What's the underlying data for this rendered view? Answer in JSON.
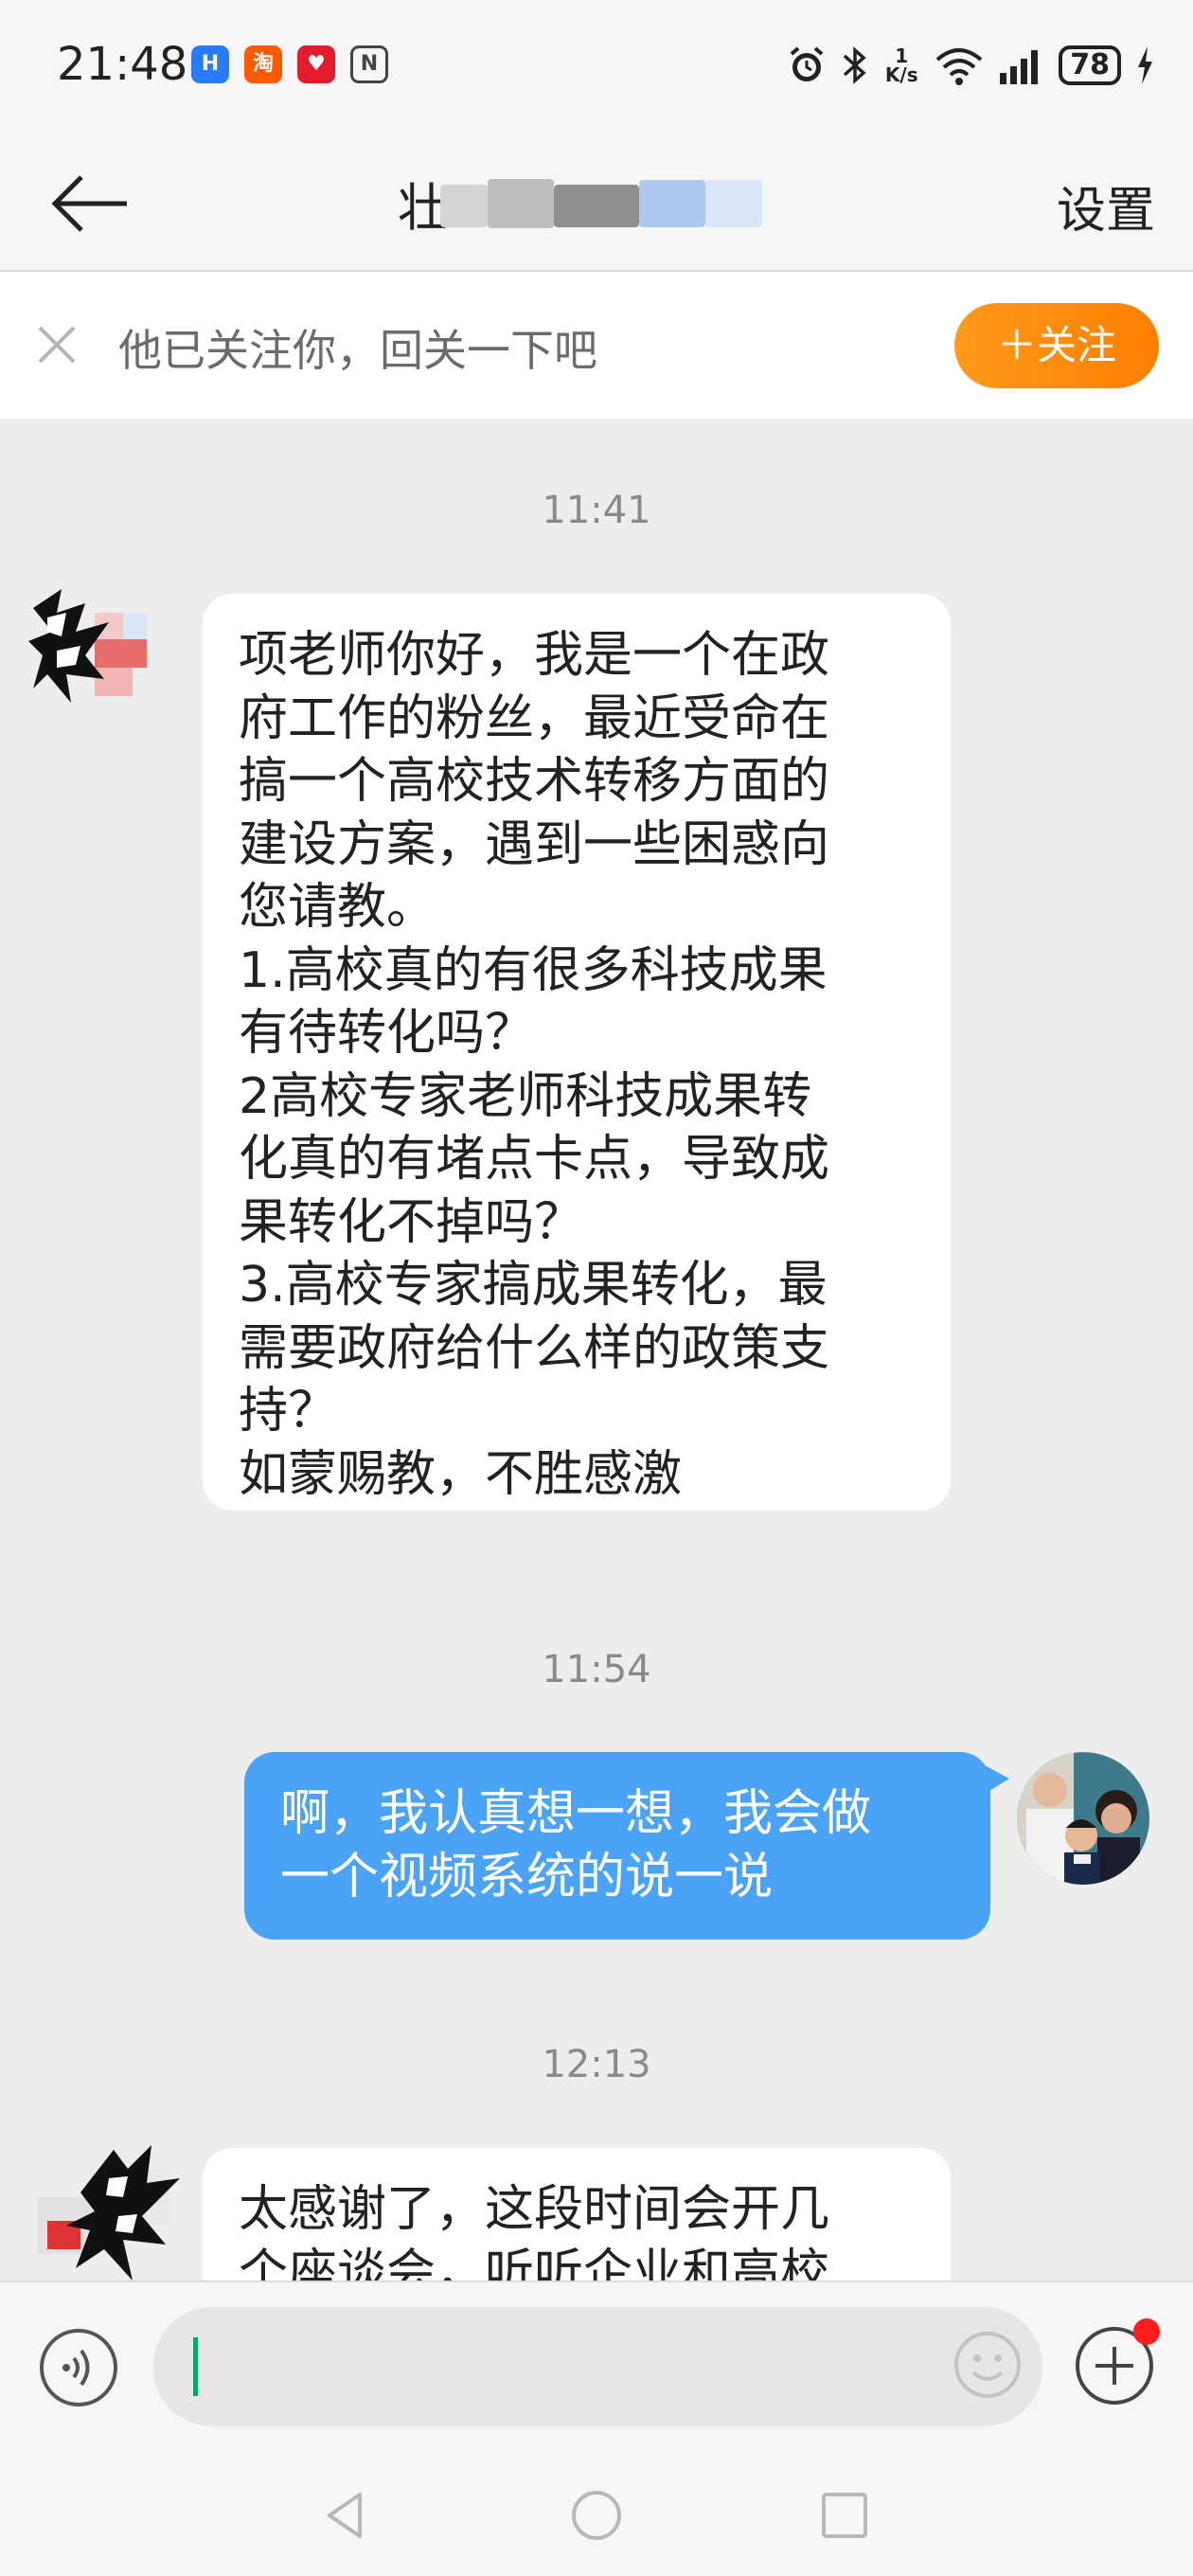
{
  "status_bar": {
    "time": "21:48",
    "apps": [
      {
        "icon": "app-blue-icon",
        "label": "H",
        "color": "#2a7cf6"
      },
      {
        "icon": "taobao-icon",
        "label": "淘",
        "color": "#ff5a00"
      },
      {
        "icon": "app-red-icon",
        "label": "♥",
        "color": "#e21b2d"
      },
      {
        "icon": "nfc-icon",
        "label": "N",
        "color": "#444444"
      }
    ],
    "network_speed_value": "1",
    "network_speed_unit": "K/s",
    "battery": "78"
  },
  "header": {
    "title": "壮",
    "settings_label": "设置"
  },
  "follow_banner": {
    "text": "他已关注你，回关一下吧",
    "button_label": "＋关注"
  },
  "messages": [
    {
      "type": "time",
      "text": "11:41"
    },
    {
      "type": "incoming",
      "lines": [
        "项老师你好，我是一个在政",
        "府工作的粉丝，最近受命在",
        "搞一个高校技术转移方面的",
        "建设方案，遇到一些困惑向",
        "您请教。",
        "1.高校真的有很多科技成果",
        "有待转化吗？",
        "2高校专家老师科技成果转",
        "化真的有堵点卡点，导致成",
        "果转化不掉吗？",
        "3.高校专家搞成果转化，最",
        "需要政府给什么样的政策支",
        "持？",
        "如蒙赐教，不胜感激"
      ]
    },
    {
      "type": "time",
      "text": "11:54"
    },
    {
      "type": "outgoing",
      "lines": [
        "啊，我认真想一想，我会做",
        "一个视频系统的说一说"
      ]
    },
    {
      "type": "time",
      "text": "12:13"
    },
    {
      "type": "incoming",
      "lines": [
        "太感谢了，这段时间会开几",
        "个座谈会，听听企业和高校"
      ]
    }
  ],
  "input_bar": {
    "placeholder": ""
  },
  "colors": {
    "accent_orange": "#ff8a00",
    "outgoing_bubble": "#4aa3f7",
    "background": "#ededed"
  }
}
